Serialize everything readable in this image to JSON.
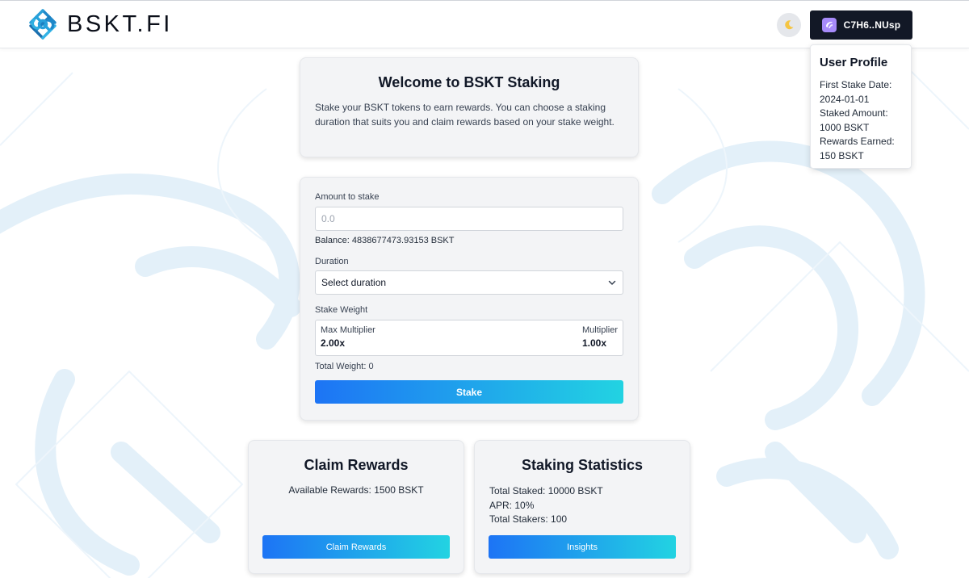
{
  "brand": {
    "name": "BSKT.FI",
    "accent": "#2a9fd8"
  },
  "header": {
    "theme_toggle_icon": "moon-icon",
    "wallet": {
      "label": "C7H6..NUsp",
      "icon": "wallet-icon"
    }
  },
  "profile": {
    "title": "User Profile",
    "first_stake_label": "First Stake Date:",
    "first_stake_value": "2024-01-01",
    "staked_label": "Staked Amount:",
    "staked_value": "1000 BSKT",
    "rewards_label": "Rewards Earned:",
    "rewards_value": "150 BSKT"
  },
  "welcome": {
    "title": "Welcome to BSKT Staking",
    "description": "Stake your BSKT tokens to earn rewards. You can choose a staking duration that suits you and claim rewards based on your stake weight."
  },
  "stake_form": {
    "amount_label": "Amount to stake",
    "amount_placeholder": "0.0",
    "balance": "Balance: 4838677473.93153 BSKT",
    "duration_label": "Duration",
    "duration_value": "Select duration",
    "weight_label": "Stake Weight",
    "max_multiplier_label": "Max Multiplier",
    "max_multiplier_value": "2.00x",
    "multiplier_label": "Multiplier",
    "multiplier_value": "1.00x",
    "total_weight": "Total Weight: 0",
    "stake_button": "Stake"
  },
  "claim": {
    "title": "Claim Rewards",
    "available": "Available Rewards: 1500 BSKT",
    "button": "Claim Rewards"
  },
  "stats": {
    "title": "Staking Statistics",
    "total_staked": "Total Staked: 10000 BSKT",
    "apr": "APR: 10%",
    "total_stakers": "Total Stakers: 100",
    "button": "Insights"
  },
  "colors": {
    "button_gradient_start": "#1d74f5",
    "button_gradient_end": "#22d3e2",
    "wallet_bg": "#121826",
    "card_bg": "#f3f4f6"
  }
}
